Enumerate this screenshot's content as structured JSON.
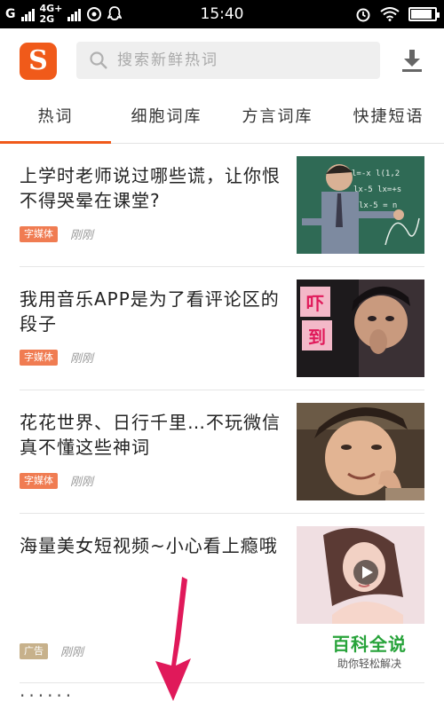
{
  "status_bar": {
    "carrier_g": "G",
    "net_top": "4G+",
    "net_bottom": "2G",
    "time": "15:40",
    "battery_level": 0.9
  },
  "top_bar": {
    "logo_letter": "S",
    "search_placeholder": "搜索新鲜热词",
    "download_icon": "download-icon"
  },
  "tabs": [
    {
      "label": "热词",
      "active": true
    },
    {
      "label": "细胞词库",
      "active": false
    },
    {
      "label": "方言词库",
      "active": false
    },
    {
      "label": "快捷短语",
      "active": false
    }
  ],
  "feed": [
    {
      "title": "上学时老师说过哪些谎，让你恨不得哭晕在课堂?",
      "badge": "字媒体",
      "time": "刚刚",
      "thumb": "teacher-chalkboard"
    },
    {
      "title": "我用音乐APP是为了看评论区的段子",
      "badge": "字媒体",
      "time": "刚刚",
      "thumb": "shocked-man",
      "thumb_text": "吓到"
    },
    {
      "title": "花花世界、日行千里…不玩微信真不懂这些神词",
      "badge": "字媒体",
      "time": "刚刚",
      "thumb": "costume-actor"
    },
    {
      "title": "海量美女短视频~小心看上瘾哦",
      "badge": "广告",
      "time": "刚刚",
      "thumb": "video-woman"
    }
  ],
  "watermark": {
    "line1": "百科全说",
    "line2": "助你轻松解决"
  },
  "colors": {
    "accent": "#f05a1a",
    "badge_media": "#f07c52",
    "badge_ad": "#c7b18b",
    "watermark_green": "#27a33a",
    "arrow": "#e0195a"
  }
}
